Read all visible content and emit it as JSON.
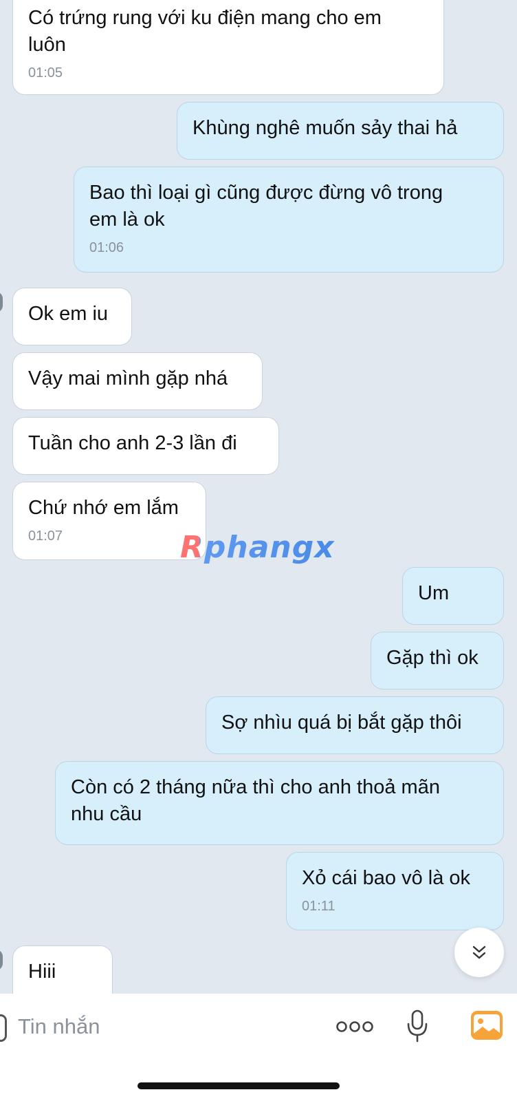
{
  "messages": [
    {
      "side": "in",
      "text": "Có trứng rung với ku điện mang cho em\nluôn",
      "time": "01:05"
    },
    {
      "side": "out",
      "text": "Khùng nghê muốn sảy thai hả"
    },
    {
      "side": "out",
      "text": "Bao thì loại gì cũng được đừng vô trong\nem là ok",
      "time": "01:06"
    },
    {
      "side": "in",
      "text": "Ok em iu"
    },
    {
      "side": "in",
      "text": "Vậy mai mình gặp nhá"
    },
    {
      "side": "in",
      "text": "Tuần cho anh 2-3 lần đi"
    },
    {
      "side": "in",
      "text": "Chứ nhớ em lắm",
      "time": "01:07"
    },
    {
      "side": "out",
      "text": "Um"
    },
    {
      "side": "out",
      "text": "Gặp thì ok"
    },
    {
      "side": "out",
      "text": "Sợ nhìu quá bị bắt gặp thôi"
    },
    {
      "side": "out",
      "text": "Còn có 2 tháng nữa thì cho anh thoả mãn\nnhu cầu"
    },
    {
      "side": "out",
      "text": "Xỏ cái bao vô là ok",
      "time": "01:11"
    },
    {
      "side": "in",
      "text": "Hiii"
    }
  ],
  "watermark": "Rphangx",
  "input": {
    "placeholder": "Tin nhắn"
  },
  "icons": {
    "scroll_down": "double-chevron-down-icon",
    "more": "more-dots-icon",
    "mic": "microphone-icon",
    "image": "image-gallery-icon"
  },
  "colors": {
    "incoming_bubble": "#ffffff",
    "outgoing_bubble": "#d7eefb",
    "background": "#e2e8ef",
    "image_icon": "#f6a33a"
  }
}
